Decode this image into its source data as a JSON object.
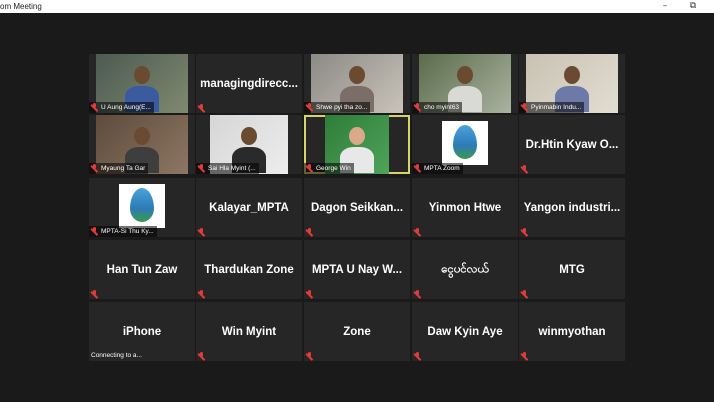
{
  "window": {
    "title": "om Meeting",
    "minimize_glyph": "–",
    "restore_glyph": "⧉"
  },
  "participants": [
    {
      "name": "U Aung Aung(E...",
      "kind": "video"
    },
    {
      "name": "managingdirecc...",
      "kind": "name"
    },
    {
      "name": "Shwe pyi tha zo...",
      "kind": "video"
    },
    {
      "name": "cho myint63",
      "kind": "video"
    },
    {
      "name": "Pyinmabin Indu...",
      "kind": "video"
    },
    {
      "name": "Myaung Ta Gar",
      "kind": "video"
    },
    {
      "name": "Sai Hla Myint (...",
      "kind": "video"
    },
    {
      "name": "George Win",
      "kind": "video",
      "active": true
    },
    {
      "name": "MPTA Zoom",
      "kind": "logo"
    },
    {
      "name": "Dr.Htin Kyaw O...",
      "kind": "name"
    },
    {
      "name": "MPTA-Si Thu Ky...",
      "kind": "logo"
    },
    {
      "name": "Kalayar_MPTA",
      "kind": "name"
    },
    {
      "name": "Dagon Seikkan...",
      "kind": "name"
    },
    {
      "name": "Yinmon Htwe",
      "kind": "name"
    },
    {
      "name": "Yangon industri...",
      "kind": "name"
    },
    {
      "name": "Han Tun Zaw",
      "kind": "name"
    },
    {
      "name": "Thardukan Zone",
      "kind": "name"
    },
    {
      "name": "MPTA U Nay W...",
      "kind": "name"
    },
    {
      "name": "ငွေပင်လယ်",
      "kind": "name"
    },
    {
      "name": "MTG",
      "kind": "name"
    },
    {
      "name": "iPhone",
      "kind": "name",
      "status": "Connecting to a..."
    },
    {
      "name": "Win Myint",
      "kind": "name"
    },
    {
      "name": "Zone",
      "kind": "name"
    },
    {
      "name": "Daw Kyin Aye",
      "kind": "name"
    },
    {
      "name": "winmyothan",
      "kind": "name"
    }
  ],
  "colors": {
    "background": "#1a1a1a",
    "tile": "#262626",
    "active_border": "#d8d46a",
    "muted_mic": "#e23b3b"
  }
}
